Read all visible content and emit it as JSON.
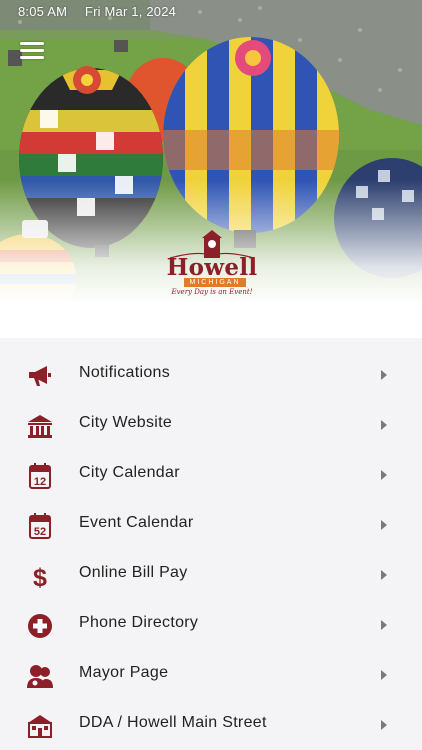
{
  "status_bar": {
    "time": "8:05 AM",
    "date": "Fri Mar 1, 2024"
  },
  "brand": {
    "name": "Howell",
    "state": "MICHIGAN",
    "tagline": "Every Day is an Event!",
    "accent_color": "#8c1f28",
    "secondary_color": "#e07b2a"
  },
  "menu": {
    "items": [
      {
        "label": "Notifications",
        "icon": "megaphone-icon"
      },
      {
        "label": "City Website",
        "icon": "city-hall-icon"
      },
      {
        "label": "City Calendar",
        "icon": "calendar-12-icon"
      },
      {
        "label": "Event Calendar",
        "icon": "calendar-52-icon"
      },
      {
        "label": "Online Bill Pay",
        "icon": "dollar-icon"
      },
      {
        "label": "Phone Directory",
        "icon": "plus-circle-icon"
      },
      {
        "label": "Mayor Page",
        "icon": "people-icon"
      },
      {
        "label": "DDA / Howell Main Street",
        "icon": "storefront-icon"
      }
    ]
  },
  "icon_glyphs": {
    "calendar_12": "12",
    "calendar_52": "52"
  }
}
